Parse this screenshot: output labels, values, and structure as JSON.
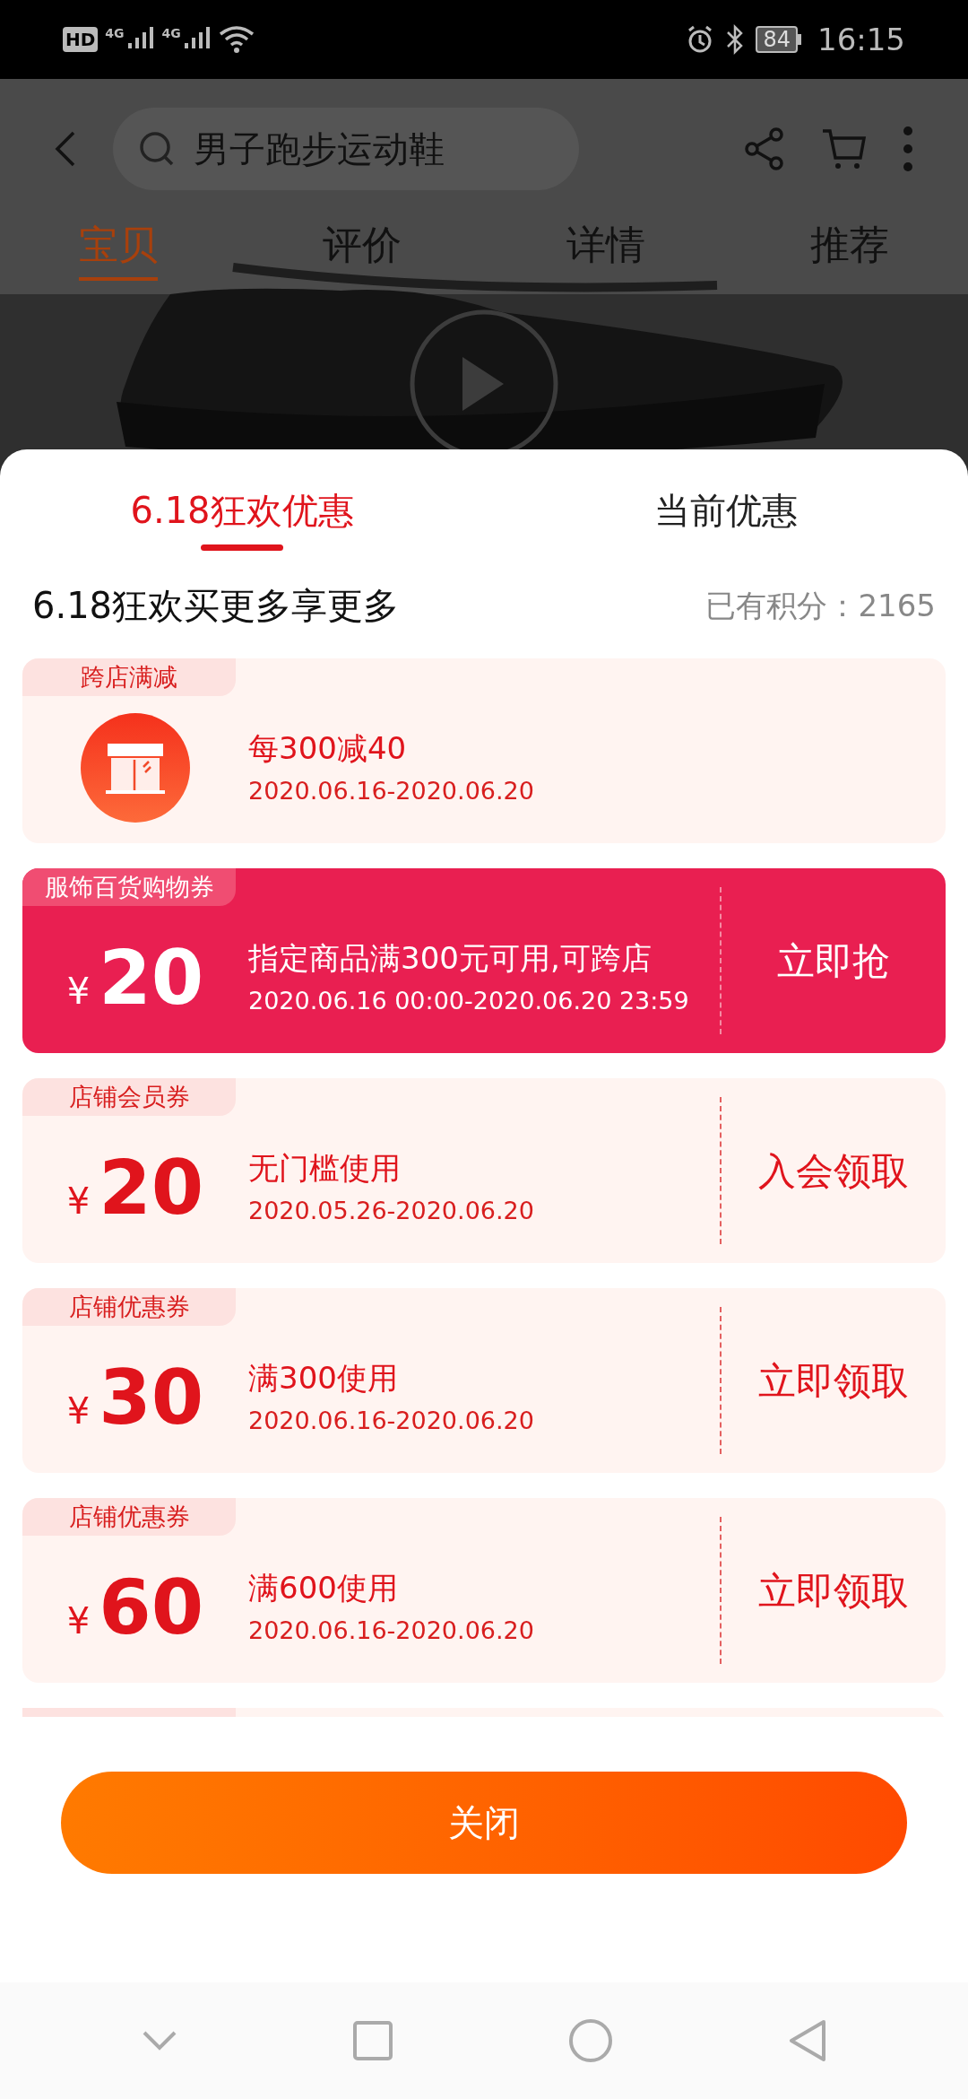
{
  "status_bar": {
    "hd": "HD",
    "networks": [
      "4G",
      "4G"
    ],
    "battery": "84",
    "time": "16:15"
  },
  "product_header": {
    "search": {
      "placeholder": "男子跑步运动鞋"
    },
    "tabs": [
      {
        "label": "宝贝",
        "selected": true
      },
      {
        "label": "评价",
        "selected": false
      },
      {
        "label": "详情",
        "selected": false
      },
      {
        "label": "推荐",
        "selected": false
      }
    ]
  },
  "sheet": {
    "tabs": [
      {
        "label": "6.18狂欢优惠",
        "selected": true
      },
      {
        "label": "当前优惠",
        "selected": false
      }
    ],
    "title": "6.18狂欢买更多享更多",
    "points": "已有积分：2165",
    "offers": [
      {
        "kind": "store",
        "tag": "跨店满减",
        "rule": "每300减40",
        "period": "2020.06.16-2020.06.20"
      },
      {
        "kind": "coupon",
        "featured": true,
        "tag": "服饰百货购物券",
        "currency": "¥",
        "amount": "20",
        "rule": "指定商品满300元可用,可跨店",
        "period": "2020.06.16 00:00-2020.06.20 23:59",
        "action": "立即抢"
      },
      {
        "kind": "coupon",
        "featured": false,
        "tag": "店铺会员券",
        "currency": "¥",
        "amount": "20",
        "rule": "无门槛使用",
        "period": "2020.05.26-2020.06.20",
        "action": "入会领取"
      },
      {
        "kind": "coupon",
        "featured": false,
        "tag": "店铺优惠券",
        "currency": "¥",
        "amount": "30",
        "rule": "满300使用",
        "period": "2020.06.16-2020.06.20",
        "action": "立即领取"
      },
      {
        "kind": "coupon",
        "featured": false,
        "tag": "店铺优惠券",
        "currency": "¥",
        "amount": "60",
        "rule": "满600使用",
        "period": "2020.06.16-2020.06.20",
        "action": "立即领取"
      }
    ],
    "close_button": "关闭"
  }
}
